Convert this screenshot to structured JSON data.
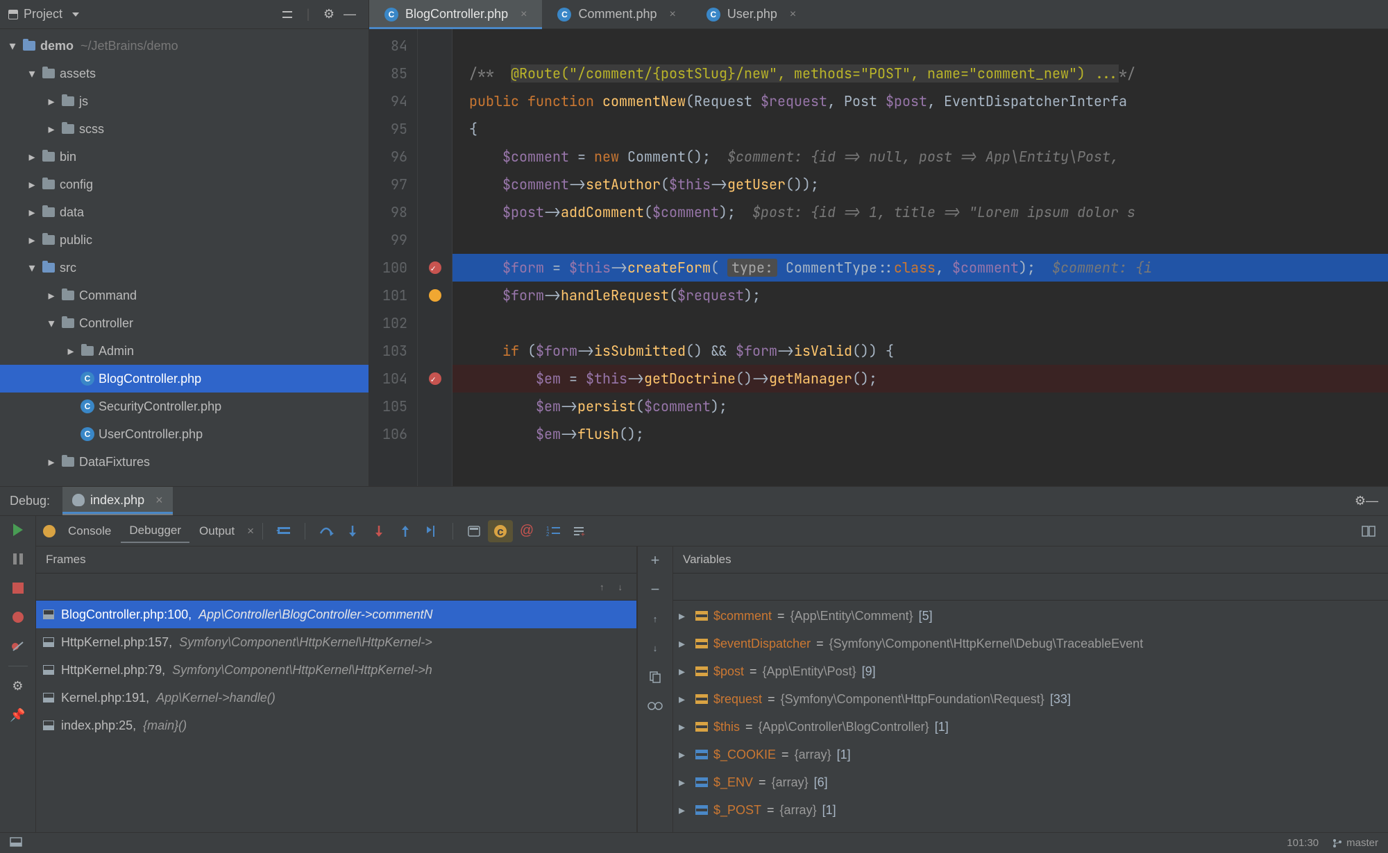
{
  "sidebar": {
    "title": "Project",
    "root": {
      "name": "demo",
      "path": "/JetBrains/demo"
    },
    "nodes": [
      {
        "indent": 0,
        "arrow": "open",
        "icon": "folder-open",
        "label": "demo",
        "extra": "~/JetBrains/demo",
        "bold": true
      },
      {
        "indent": 1,
        "arrow": "open",
        "icon": "folder",
        "label": "assets"
      },
      {
        "indent": 2,
        "arrow": "closed",
        "icon": "folder",
        "label": "js"
      },
      {
        "indent": 2,
        "arrow": "closed",
        "icon": "folder",
        "label": "scss"
      },
      {
        "indent": 1,
        "arrow": "closed",
        "icon": "folder",
        "label": "bin"
      },
      {
        "indent": 1,
        "arrow": "closed",
        "icon": "folder",
        "label": "config"
      },
      {
        "indent": 1,
        "arrow": "closed",
        "icon": "folder",
        "label": "data"
      },
      {
        "indent": 1,
        "arrow": "closed",
        "icon": "folder",
        "label": "public"
      },
      {
        "indent": 1,
        "arrow": "open",
        "icon": "folder-open",
        "label": "src"
      },
      {
        "indent": 2,
        "arrow": "closed",
        "icon": "folder",
        "label": "Command"
      },
      {
        "indent": 2,
        "arrow": "open",
        "icon": "folder",
        "label": "Controller"
      },
      {
        "indent": 3,
        "arrow": "closed",
        "icon": "folder",
        "label": "Admin"
      },
      {
        "indent": 3,
        "arrow": "none",
        "icon": "php",
        "label": "BlogController.php",
        "selected": true
      },
      {
        "indent": 3,
        "arrow": "none",
        "icon": "php",
        "label": "SecurityController.php"
      },
      {
        "indent": 3,
        "arrow": "none",
        "icon": "php",
        "label": "UserController.php"
      },
      {
        "indent": 2,
        "arrow": "closed",
        "icon": "folder",
        "label": "DataFixtures"
      }
    ]
  },
  "editor": {
    "tabs": [
      {
        "label": "BlogController.php",
        "active": true
      },
      {
        "label": "Comment.php",
        "active": false
      },
      {
        "label": "User.php",
        "active": false
      }
    ],
    "lineNumbers": [
      "84",
      "85",
      "94",
      "95",
      "96",
      "97",
      "98",
      "99",
      "100",
      "101",
      "102",
      "103",
      "104",
      "105",
      "106"
    ],
    "gutter": [
      "",
      "",
      "",
      "",
      "",
      "",
      "",
      "",
      "bp",
      "bulb",
      "",
      "",
      "bp",
      "",
      ""
    ],
    "code": {
      "l85_anno": "@Route(\"/comment/{postSlug}/new\", methods=\"POST\", name=\"comment_new\") ...",
      "l94_kw1": "public",
      "l94_kw2": "function",
      "l94_fn": "commentNew",
      "l94_sig1": "(Request ",
      "l94_var1": "$request",
      "l94_sig2": ", Post ",
      "l94_var2": "$post",
      "l94_sig3": ", EventDispatcherInterfa",
      "l96_var": "$comment",
      "l96_kw": "new",
      "l96_cls": "Comment",
      "l96_hint": "$comment: {id => null, post => App\\Entity\\Post, ",
      "l97_var": "$comment",
      "l97_fn": "setAuthor",
      "l97_this": "$this",
      "l97_fn2": "getUser",
      "l98_var": "$post",
      "l98_fn": "addComment",
      "l98_arg": "$comment",
      "l98_hint": "$post: {id => 1, title => \"Lorem ipsum dolor s",
      "l100_var": "$form",
      "l100_this": "$this",
      "l100_fn": "createForm",
      "l100_param": "type:",
      "l100_cls": "CommentType",
      "l100_kw": "class",
      "l100_arg": "$comment",
      "l100_hint": "$comment: {i",
      "l101_var": "$form",
      "l101_fn": "handleRequest",
      "l101_arg": "$request",
      "l103_kw": "if",
      "l103_v1": "$form",
      "l103_fn1": "isSubmitted",
      "l103_v2": "$form",
      "l103_fn2": "isValid",
      "l104_var": "$em",
      "l104_this": "$this",
      "l104_fn1": "getDoctrine",
      "l104_fn2": "getManager",
      "l105_var": "$em",
      "l105_fn": "persist",
      "l105_arg": "$comment",
      "l106_var": "$em",
      "l106_fn": "flush"
    }
  },
  "debug": {
    "title": "Debug:",
    "session": "index.php",
    "tabs": {
      "console": "Console",
      "debugger": "Debugger",
      "output": "Output"
    },
    "framesTitle": "Frames",
    "varsTitle": "Variables",
    "frames": [
      {
        "loc": "BlogController.php:100,",
        "ctx": "App\\Controller\\BlogController->commentN",
        "selected": true
      },
      {
        "loc": "HttpKernel.php:157,",
        "ctx": "Symfony\\Component\\HttpKernel\\HttpKernel->",
        "selected": false
      },
      {
        "loc": "HttpKernel.php:79,",
        "ctx": "Symfony\\Component\\HttpKernel\\HttpKernel->h",
        "selected": false
      },
      {
        "loc": "Kernel.php:191,",
        "ctx": "App\\Kernel->handle()",
        "selected": false
      },
      {
        "loc": "index.php:25,",
        "ctx": "{main}()",
        "selected": false
      }
    ],
    "vars": [
      {
        "kind": "obj",
        "name": "$comment",
        "val": "{App\\Entity\\Comment}",
        "count": "[5]"
      },
      {
        "kind": "obj",
        "name": "$eventDispatcher",
        "val": "{Symfony\\Component\\HttpKernel\\Debug\\TraceableEvent",
        "count": ""
      },
      {
        "kind": "obj",
        "name": "$post",
        "val": "{App\\Entity\\Post}",
        "count": "[9]"
      },
      {
        "kind": "obj",
        "name": "$request",
        "val": "{Symfony\\Component\\HttpFoundation\\Request}",
        "count": "[33]"
      },
      {
        "kind": "obj",
        "name": "$this",
        "val": "{App\\Controller\\BlogController}",
        "count": "[1]"
      },
      {
        "kind": "arr",
        "name": "$_COOKIE",
        "val": "{array}",
        "count": "[1]"
      },
      {
        "kind": "arr",
        "name": "$_ENV",
        "val": "{array}",
        "count": "[6]"
      },
      {
        "kind": "arr",
        "name": "$_POST",
        "val": "{array}",
        "count": "[1]"
      }
    ]
  },
  "status": {
    "pos": "101:30",
    "branch": "master"
  }
}
